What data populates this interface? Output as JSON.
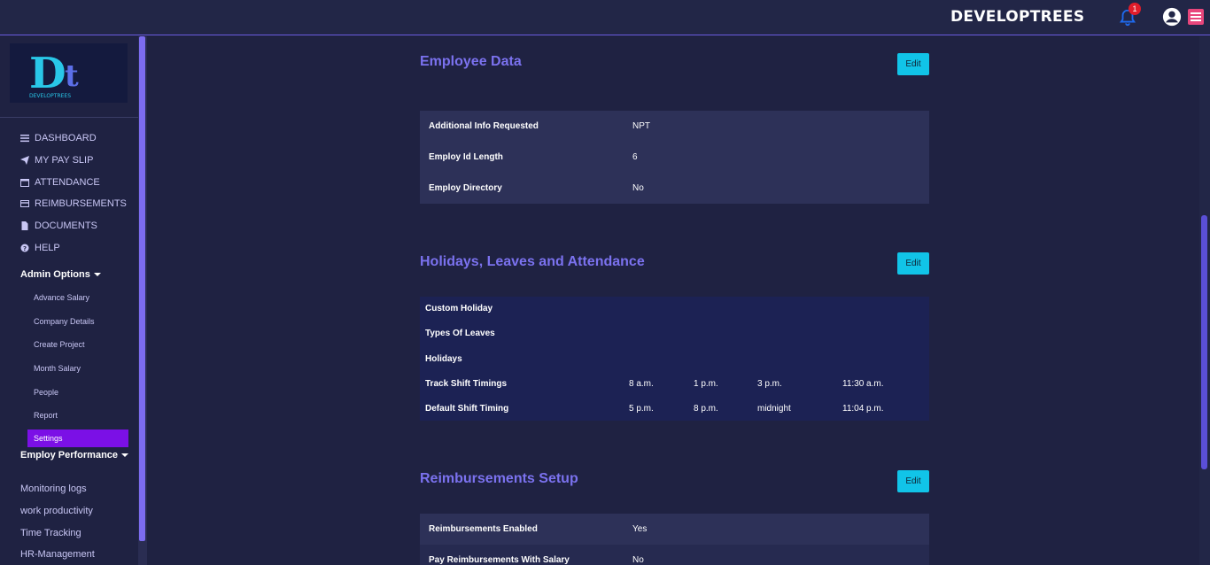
{
  "header": {
    "brand": "DEVELOPTREES",
    "notification_count": "1"
  },
  "logo": {
    "text": "DEVELOPTREES"
  },
  "sidebar": {
    "items": [
      {
        "label": "DASHBOARD",
        "icon": "bars-icon"
      },
      {
        "label": "MY PAY SLIP",
        "icon": "paper-plane-icon"
      },
      {
        "label": "ATTENDANCE",
        "icon": "calendar-icon"
      },
      {
        "label": "REIMBURSEMENTS",
        "icon": "credit-card-icon"
      },
      {
        "label": "DOCUMENTS",
        "icon": "file-icon"
      },
      {
        "label": "HELP",
        "icon": "question-icon"
      }
    ],
    "admin_heading": "Admin Options",
    "admin_items": [
      "Advance Salary",
      "Company Details",
      "Create Project",
      "Month Salary",
      "People",
      "Report"
    ],
    "active_item": "Settings",
    "performance_heading": "Employ Performance",
    "links": [
      "Monitoring logs",
      "work productivity",
      "Time Tracking",
      "HR-Management"
    ]
  },
  "employee_data": {
    "title": "Employee Data",
    "edit": "Edit",
    "rows": [
      {
        "key": "Additional Info Requested",
        "value": "NPT"
      },
      {
        "key": "Employ Id Length",
        "value": "6"
      },
      {
        "key": "Employ Directory",
        "value": "No"
      }
    ]
  },
  "holidays": {
    "title": "Holidays, Leaves and Attendance",
    "edit": "Edit",
    "rows": [
      {
        "key": "Custom Holiday",
        "cols": []
      },
      {
        "key": "Types Of Leaves",
        "cols": []
      },
      {
        "key": "Holidays",
        "cols": []
      },
      {
        "key": "Track Shift Timings",
        "cols": [
          "8 a.m.",
          "1 p.m.",
          "3 p.m.",
          "11:30 a.m."
        ]
      },
      {
        "key": "Default Shift Timing",
        "cols": [
          "5 p.m.",
          "8 p.m.",
          "midnight",
          "11:04 p.m."
        ]
      }
    ]
  },
  "reimbursements": {
    "title": "Reimbursements Setup",
    "edit": "Edit",
    "rows": [
      {
        "key": "Reimbursements Enabled",
        "value": "Yes"
      },
      {
        "key": "Pay Reimbursements With Salary",
        "value": "No"
      }
    ]
  },
  "colors": {
    "accent": "#7b72ef",
    "button": "#11c4e8",
    "active": "#7b10e6",
    "badge": "#e11d2a"
  }
}
